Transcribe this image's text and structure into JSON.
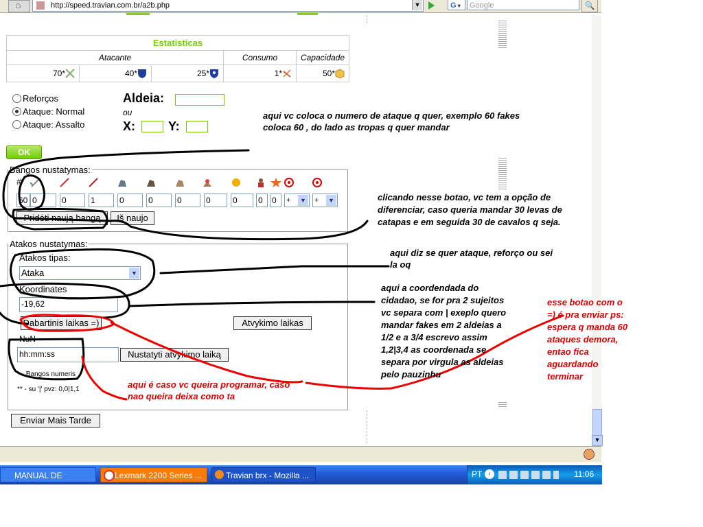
{
  "browser": {
    "url": "http://speed.travian.com.br/a2b.php",
    "search_engine": "G",
    "search_placeholder": "Google"
  },
  "stats": {
    "title": "Estatisticas",
    "headers": [
      "Atacante",
      "Consumo",
      "Capacidade"
    ],
    "values": [
      "70*",
      "40*",
      "25*",
      "1*",
      "50*"
    ],
    "title_color": "#71d000"
  },
  "troop_type": {
    "options": [
      "Reforços",
      "Ataque: Normal",
      "Ataque: Assalto"
    ],
    "selected_index": 1
  },
  "target": {
    "village_label": "Aldeia:",
    "or_label": "ou",
    "x_label": "X:",
    "y_label": "Y:"
  },
  "ok_label": "OK",
  "wave_settings": {
    "legend": "Bangos nustatymas:",
    "hash_label": "#*",
    "inputs": [
      "60",
      "0",
      "0",
      "1",
      "0",
      "0",
      "0",
      "0",
      "0",
      "0",
      "0"
    ],
    "plus_values": [
      "+",
      "+"
    ],
    "add_wave_label": "Pridėti naują bangą",
    "reset_label": "Iš naujo"
  },
  "attack_settings": {
    "legend": "Atakos nustatymas:",
    "type_label": "Atakos tipas:",
    "type_value": "Ataka",
    "coords_label": "Koordinates",
    "coords_value": "-19,62",
    "current_time_label": "Dabartinis laikas =)",
    "attack_time_label": "Atvykimo laikas",
    "nun_label": "NuN",
    "time_value": "hh:mm:ss",
    "set_time_label": "Nustatyti atvykimo laiką",
    "note1": "* - Bangos numeris",
    "note2": "** - su '|' pvz: 0,0|1,1"
  },
  "send_later_label": "Enviar Mais Tarde",
  "annotations": {
    "a1": "aqui vc coloca o numero de ataque q quer, exemplo 60 fakes coloca 60 , do lado as tropas q quer mandar",
    "a2": "clicando nesse botao, vc tem a opção de diferenciar, caso queria mandar 30 levas de catapas e em seguida 30 de cavalos q seja.",
    "a3": "aqui diz se quer ataque, reforço ou sei la oq",
    "a4": "aqui a coordendada do cidadao, se for pra 2 sujeitos vc separa com | exeplo quero mandar fakes em 2 aldeias a 1/2 e a 3/4  escrevo assim 1,2|3,4  as coordenada se separa por virgula as aldeias pelo pauzinhu",
    "a5": "esse botao com o =) é pra enviar  ps: espera q manda 60 ataques demora, entao fica aguardando terminar",
    "a6": "aqui é caso vc queira programar, caso nao queira deixa como ta"
  },
  "taskbar": {
    "tasks": [
      "MANUAL DE INSTALA...",
      "Lexmark 2200 Series ...",
      "Travian brx - Mozilla ..."
    ],
    "lang": "PT",
    "clock": "11:06"
  }
}
